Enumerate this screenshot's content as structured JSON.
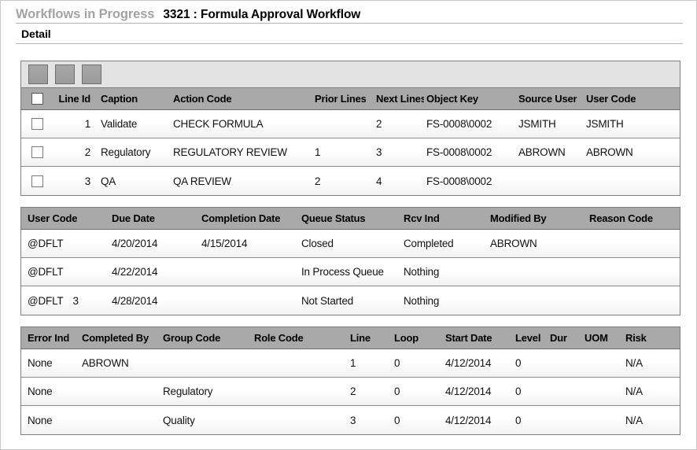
{
  "header": {
    "breadcrumb": "Workflows in Progress",
    "title": "3321 : Formula Approval Workflow",
    "section": "Detail"
  },
  "toolbar": {
    "buttons": [
      {
        "name": "toolbar-button-1",
        "label": ""
      },
      {
        "name": "toolbar-button-2",
        "label": ""
      },
      {
        "name": "toolbar-button-3",
        "label": ""
      }
    ]
  },
  "lines_grid": {
    "columns": {
      "line_id": "Line Id",
      "caption": "Caption",
      "action_code": "Action Code",
      "prior_lines": "Prior Lines",
      "next_lines": "Next Lines",
      "object_key": "Object Key",
      "source_user": "Source User",
      "user_code": "User Code"
    },
    "rows": [
      {
        "line_id": "1",
        "caption": "Validate",
        "action_code": "CHECK FORMULA",
        "prior_lines": "",
        "next_lines": "2",
        "object_key": "FS-0008\\0002",
        "source_user": "JSMITH",
        "user_code": "JSMITH"
      },
      {
        "line_id": "2",
        "caption": "Regulatory",
        "action_code": "REGULATORY REVIEW",
        "prior_lines": "1",
        "next_lines": "3",
        "object_key": "FS-0008\\0002",
        "source_user": "ABROWN",
        "user_code": "ABROWN"
      },
      {
        "line_id": "3",
        "caption": "QA",
        "action_code": "QA REVIEW",
        "prior_lines": "2",
        "next_lines": "4",
        "object_key": "FS-0008\\0002",
        "source_user": "",
        "user_code": ""
      }
    ]
  },
  "queue_grid": {
    "columns": {
      "user_code": "User Code",
      "due_date": "Due Date",
      "completion_date": "Completion Date",
      "queue_status": "Queue Status",
      "rcv_ind": "Rcv Ind",
      "modified_by": "Modified By",
      "reason_code": "Reason Code"
    },
    "rows": [
      {
        "user_code": "@DFLT",
        "user_code_extra": "",
        "due_date": "4/20/2014",
        "completion_date": "4/15/2014",
        "queue_status": "Closed",
        "rcv_ind": "Completed",
        "modified_by": "ABROWN",
        "reason_code": ""
      },
      {
        "user_code": "@DFLT",
        "user_code_extra": "",
        "due_date": "4/22/2014",
        "completion_date": "",
        "queue_status": "In Process Queue",
        "rcv_ind": "Nothing",
        "modified_by": "",
        "reason_code": ""
      },
      {
        "user_code": "@DFLT",
        "user_code_extra": "3",
        "due_date": "4/28/2014",
        "completion_date": "",
        "queue_status": "Not Started",
        "rcv_ind": "Nothing",
        "modified_by": "",
        "reason_code": ""
      }
    ]
  },
  "status_grid": {
    "columns": {
      "error_ind": "Error Ind",
      "completed_by": "Completed By",
      "group_code": "Group Code",
      "role_code": "Role Code",
      "line": "Line",
      "loop": "Loop",
      "start_date": "Start Date",
      "level": "Level",
      "dur": "Dur",
      "uom": "UOM",
      "risk": "Risk"
    },
    "rows": [
      {
        "error_ind": "None",
        "completed_by": "ABROWN",
        "group_code": "",
        "role_code": "",
        "line": "1",
        "loop": "0",
        "start_date": "4/12/2014",
        "level": "0",
        "dur": "",
        "uom": "",
        "risk": "N/A"
      },
      {
        "error_ind": "None",
        "completed_by": "",
        "group_code": "Regulatory",
        "role_code": "",
        "line": "2",
        "loop": "0",
        "start_date": "4/12/2014",
        "level": "0",
        "dur": "",
        "uom": "",
        "risk": "N/A"
      },
      {
        "error_ind": "None",
        "completed_by": "",
        "group_code": "Quality",
        "role_code": "",
        "line": "3",
        "loop": "0",
        "start_date": "4/12/2014",
        "level": "0",
        "dur": "",
        "uom": "",
        "risk": "N/A"
      }
    ]
  },
  "colors": {
    "header_row": "#a9a9a9",
    "toolbar": "#e3e3a3",
    "breadcrumb_text": "#a3a3a3",
    "grid_border": "#7f7f7f"
  }
}
